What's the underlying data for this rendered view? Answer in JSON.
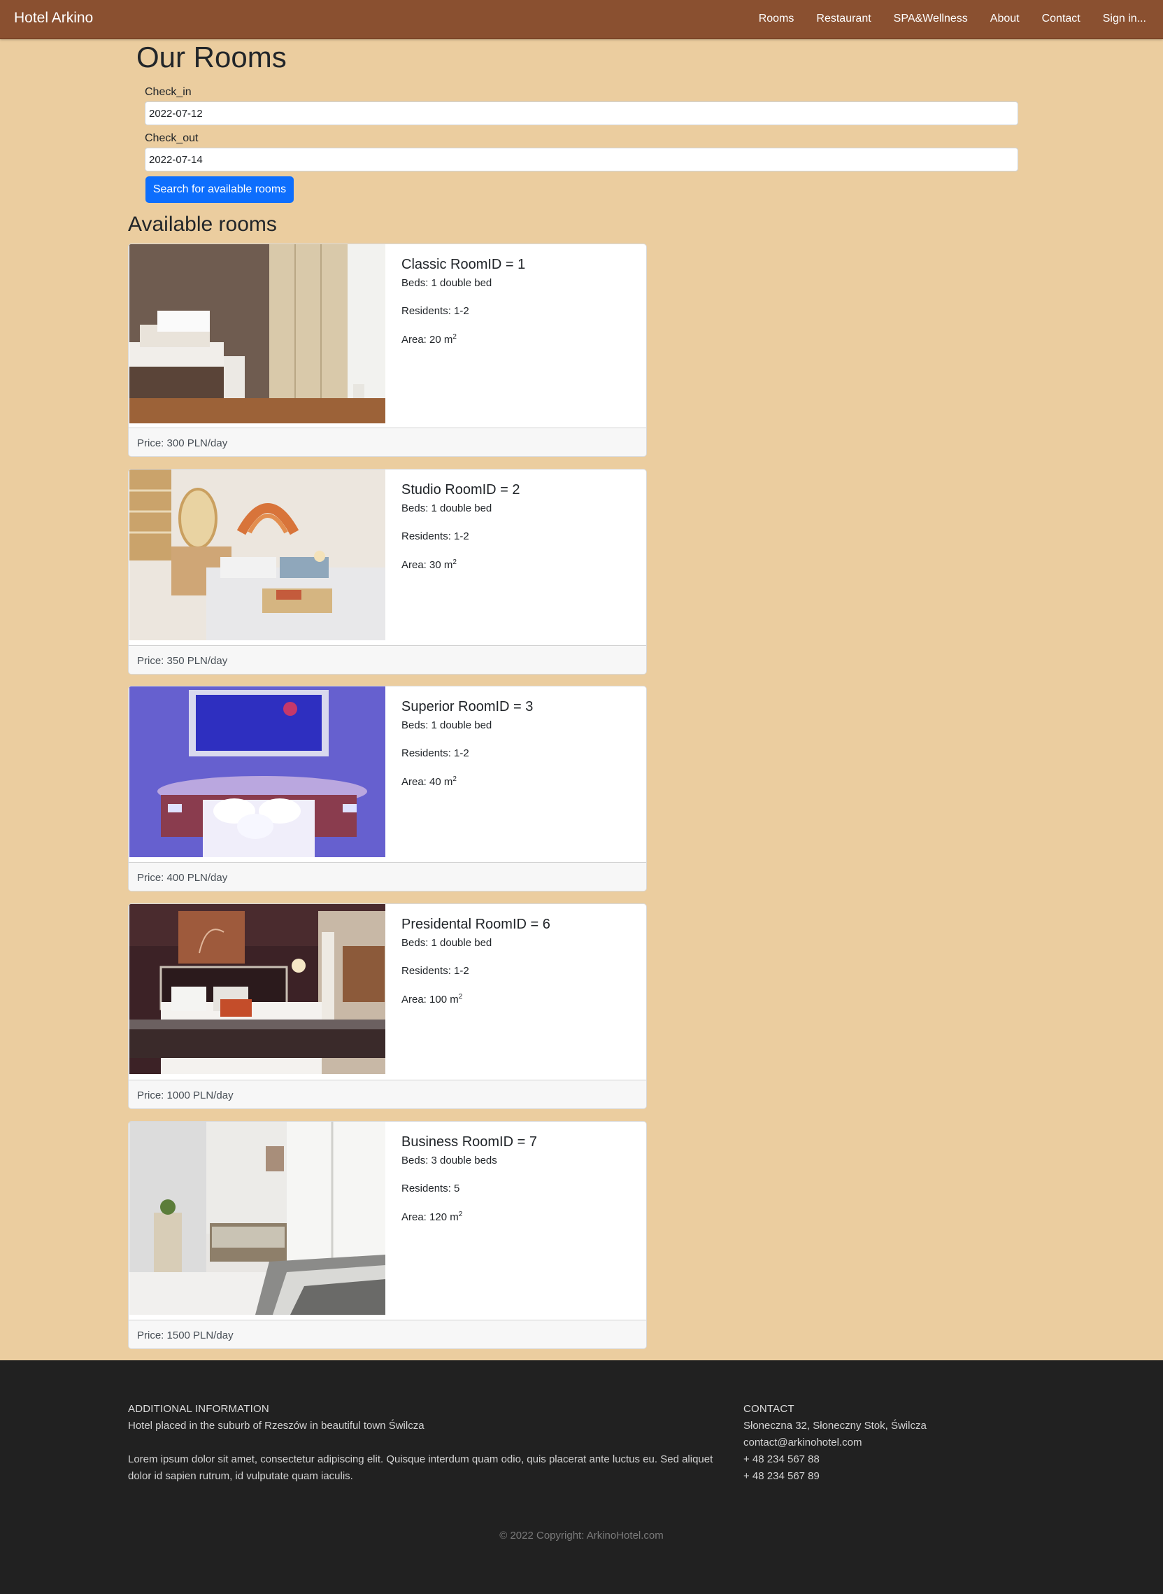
{
  "navbar": {
    "brand": "Hotel Arkino",
    "links": [
      "Rooms",
      "Restaurant",
      "SPA&Wellness",
      "About",
      "Contact",
      "Sign in..."
    ]
  },
  "page_title": "Our Rooms",
  "search": {
    "checkin_label": "Check_in",
    "checkin_value": "2022-07-12",
    "checkout_label": "Check_out",
    "checkout_value": "2022-07-14",
    "button_label": "Search for available rooms"
  },
  "section_title": "Available rooms",
  "rooms": [
    {
      "title": "Classic RoomID = 1",
      "beds": "Beds: 1 double bed",
      "residents": "Residents: 1-2",
      "area": "Area: 20 m",
      "price": "Price: 300 PLN/day"
    },
    {
      "title": "Studio RoomID = 2",
      "beds": "Beds: 1 double bed",
      "residents": "Residents: 1-2",
      "area": "Area: 30 m",
      "price": "Price: 350 PLN/day"
    },
    {
      "title": "Superior RoomID = 3",
      "beds": "Beds: 1 double bed",
      "residents": "Residents: 1-2",
      "area": "Area: 40 m",
      "price": "Price: 400 PLN/day"
    },
    {
      "title": "Presidental RoomID = 6",
      "beds": "Beds: 1 double bed",
      "residents": "Residents: 1-2",
      "area": "Area: 100 m",
      "price": "Price: 1000 PLN/day"
    },
    {
      "title": "Business RoomID = 7",
      "beds": "Beds: 3 double beds",
      "residents": "Residents: 5",
      "area": "Area: 120 m",
      "price": "Price: 1500 PLN/day"
    }
  ],
  "area_superscript": "2",
  "footer": {
    "info_heading": "ADDITIONAL INFORMATION",
    "info_line": "Hotel placed in the suburb of Rzeszów in beautiful town Świlcza",
    "lorem": "Lorem ipsum dolor sit amet, consectetur adipiscing elit. Quisque interdum quam odio, quis placerat ante luctus eu. Sed aliquet dolor id sapien rutrum, id vulputate quam iaculis.",
    "contact_heading": "CONTACT",
    "address": "Słoneczna 32, Słoneczny Stok, Świlcza",
    "email": "contact@arkinohotel.com",
    "phone1": "+ 48 234 567 88",
    "phone2": "+ 48 234 567 89",
    "copyright": "© 2022 Copyright: ArkinoHotel.com"
  },
  "colors": {
    "navbar": "#8a5030",
    "page_background": "#ebcd9f",
    "primary_button": "#0d6efd",
    "footer": "#212121"
  }
}
